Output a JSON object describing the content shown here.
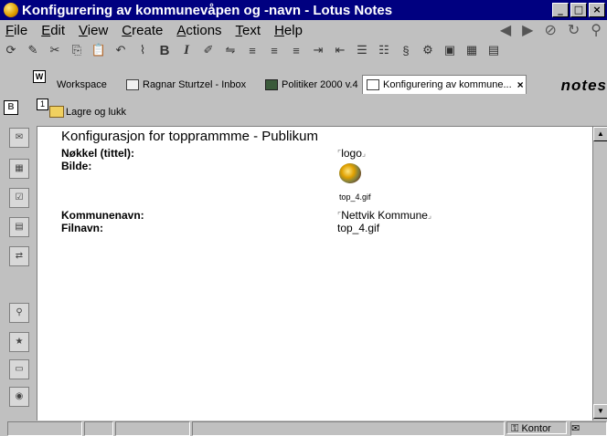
{
  "window": {
    "title": "Konfigurering av kommunevåpen og -navn - Lotus Notes"
  },
  "menu": [
    {
      "label": "File",
      "key": "F",
      "rest": "ile"
    },
    {
      "label": "Edit",
      "key": "E",
      "rest": "dit"
    },
    {
      "label": "View",
      "key": "V",
      "rest": "iew"
    },
    {
      "label": "Create",
      "key": "C",
      "rest": "reate"
    },
    {
      "label": "Actions",
      "key": "A",
      "rest": "ctions"
    },
    {
      "label": "Text",
      "key": "T",
      "rest": "ext"
    },
    {
      "label": "Help",
      "key": "H",
      "rest": "elp"
    }
  ],
  "tabs": [
    {
      "label": "Workspace"
    },
    {
      "label": "Ragnar Sturtzel - Inbox"
    },
    {
      "label": "Politiker 2000 v.4"
    },
    {
      "label": "Konfigurering av kommune..."
    }
  ],
  "brand": "notes",
  "actionbar": {
    "page_number": "1",
    "save_close": "Lagre og lukk"
  },
  "workspace_badge": "W",
  "left_badge": "B",
  "document": {
    "heading": "Konfigurasjon for topprammme - Publikum",
    "fields": [
      {
        "label": "Nøkkel (tittel):",
        "value": "logo"
      },
      {
        "label": "Bilde:",
        "value": "top_4.gif"
      },
      {
        "label": "Kommunenavn:",
        "value": "Nettvik Kommune"
      },
      {
        "label": "Filnavn:",
        "value": "top_4.gif"
      }
    ]
  },
  "status": {
    "location": "Kontor"
  }
}
